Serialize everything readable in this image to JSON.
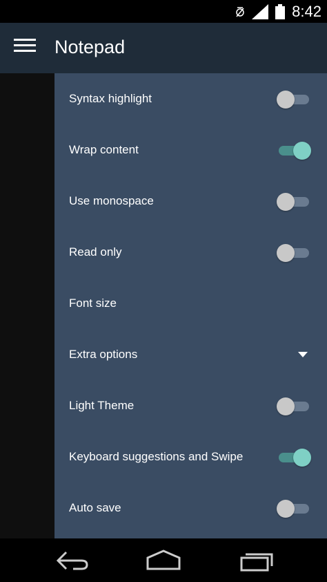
{
  "status_bar": {
    "time": "8:42",
    "icons": [
      "alarm-icon",
      "signal-icon",
      "battery-icon"
    ]
  },
  "app_bar": {
    "title": "Notepad",
    "menu_icon": "menu-icon"
  },
  "colors": {
    "app_bar": "#1f2c39",
    "drawer": "#3a4c63",
    "toggle_on": "#7fd0c5",
    "toggle_off": "#c8c8c8"
  },
  "settings": [
    {
      "label": "Syntax highlight",
      "type": "toggle",
      "checked": false
    },
    {
      "label": "Wrap content",
      "type": "toggle",
      "checked": true
    },
    {
      "label": "Use monospace",
      "type": "toggle",
      "checked": false
    },
    {
      "label": "Read only",
      "type": "toggle",
      "checked": false
    },
    {
      "label": "Font size",
      "type": "item"
    },
    {
      "label": "Extra options",
      "type": "dropdown"
    },
    {
      "label": "Light Theme",
      "type": "toggle",
      "checked": false
    },
    {
      "label": "Keyboard suggestions and Swipe",
      "type": "toggle",
      "checked": true
    },
    {
      "label": "Auto save",
      "type": "toggle",
      "checked": false
    }
  ],
  "nav_bar": {
    "icons": [
      "back-icon",
      "home-icon",
      "recents-icon"
    ]
  }
}
